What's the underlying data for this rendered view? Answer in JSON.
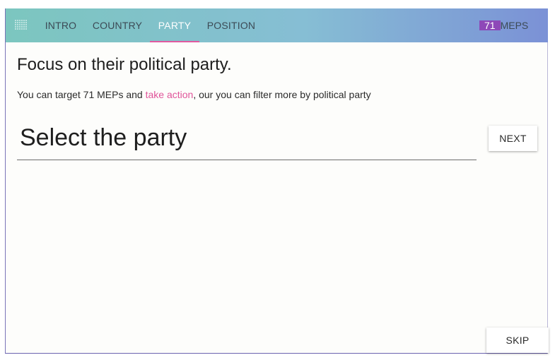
{
  "nav": {
    "tabs": [
      {
        "label": "INTRO",
        "active": false
      },
      {
        "label": "COUNTRY",
        "active": false
      },
      {
        "label": "PARTY",
        "active": true
      },
      {
        "label": "POSITION",
        "active": false
      }
    ],
    "meps_count": "71",
    "meps_label": "MEPS",
    "logo_icon": "dots-grid-icon"
  },
  "main": {
    "title": "Focus on their political party.",
    "intro_before": "You can target 71 MEPs and ",
    "intro_link": "take action",
    "intro_after": ", our you can filter more by political party",
    "select_label": "Select the party",
    "next_label": "NEXT",
    "skip_label": "SKIP"
  },
  "colors": {
    "accent": "#e05aa0",
    "badge": "#8e48b8"
  }
}
